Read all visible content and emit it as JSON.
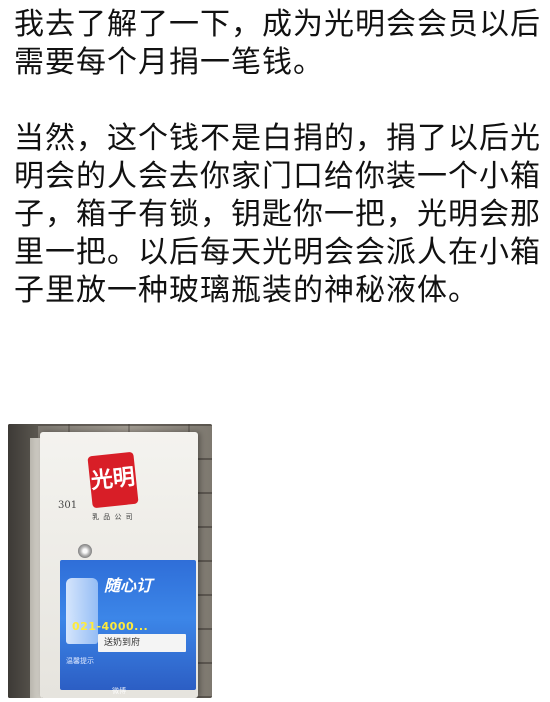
{
  "post": {
    "paragraph1": "我去了解了一下，成为光明会会员以后需要每个月捐一笔钱。",
    "paragraph2": "当然，这个钱不是白捐的，捐了以后光明会的人会去你家门口给你装一个小箱子，箱子有锁，钥匙你一把，光明会那里一把。以后每天光明会会派人在小箱子里放一种玻璃瓶装的神秘液体。"
  },
  "photo": {
    "logo_text": "光明",
    "logo_subtitle": "乳 品 公 司",
    "handwritten_mark": "301",
    "sticker_brand": "随心订",
    "sticker_phone": "021-4000...",
    "sticker_box_text": "送奶到府",
    "sticker_tip": "温馨提示",
    "watermark": "微博"
  },
  "colors": {
    "logo_red": "#d81e27",
    "sticker_blue": "#2f6ed8",
    "phone_yellow": "#ffeb3b"
  }
}
